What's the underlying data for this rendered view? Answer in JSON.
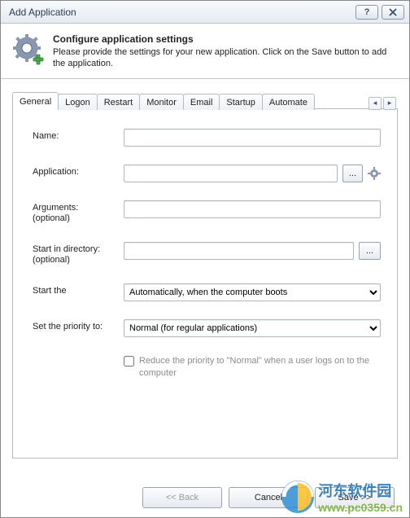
{
  "titlebar": {
    "title": "Add Application"
  },
  "header": {
    "title": "Configure application settings",
    "subtitle": "Please provide the settings for your new application. Click on the Save button to add the application."
  },
  "tabs": {
    "items": [
      "General",
      "Logon",
      "Restart",
      "Monitor",
      "Email",
      "Startup",
      "Automate"
    ],
    "active_index": 0
  },
  "form": {
    "name": {
      "label": "Name:",
      "value": ""
    },
    "application": {
      "label": "Application:",
      "value": "",
      "browse": "..."
    },
    "arguments": {
      "label": "Arguments:\n  (optional)",
      "value": ""
    },
    "start_dir": {
      "label": "Start in directory:\n  (optional)",
      "value": "",
      "browse": "..."
    },
    "start_the": {
      "label": "Start the",
      "selected": "Automatically, when the computer boots",
      "options": [
        "Automatically, when the computer boots"
      ]
    },
    "priority": {
      "label": "Set the priority to:",
      "selected": "Normal (for regular applications)",
      "options": [
        "Normal (for regular applications)"
      ]
    },
    "reduce_priority": {
      "label": "Reduce the priority to \"Normal\" when a user logs on to the computer",
      "checked": false
    }
  },
  "footer": {
    "back": "<< Back",
    "cancel": "Cancel",
    "save": "Save >>"
  },
  "watermark": {
    "text": "河东软件园",
    "url": "www.pc0359.cn"
  }
}
